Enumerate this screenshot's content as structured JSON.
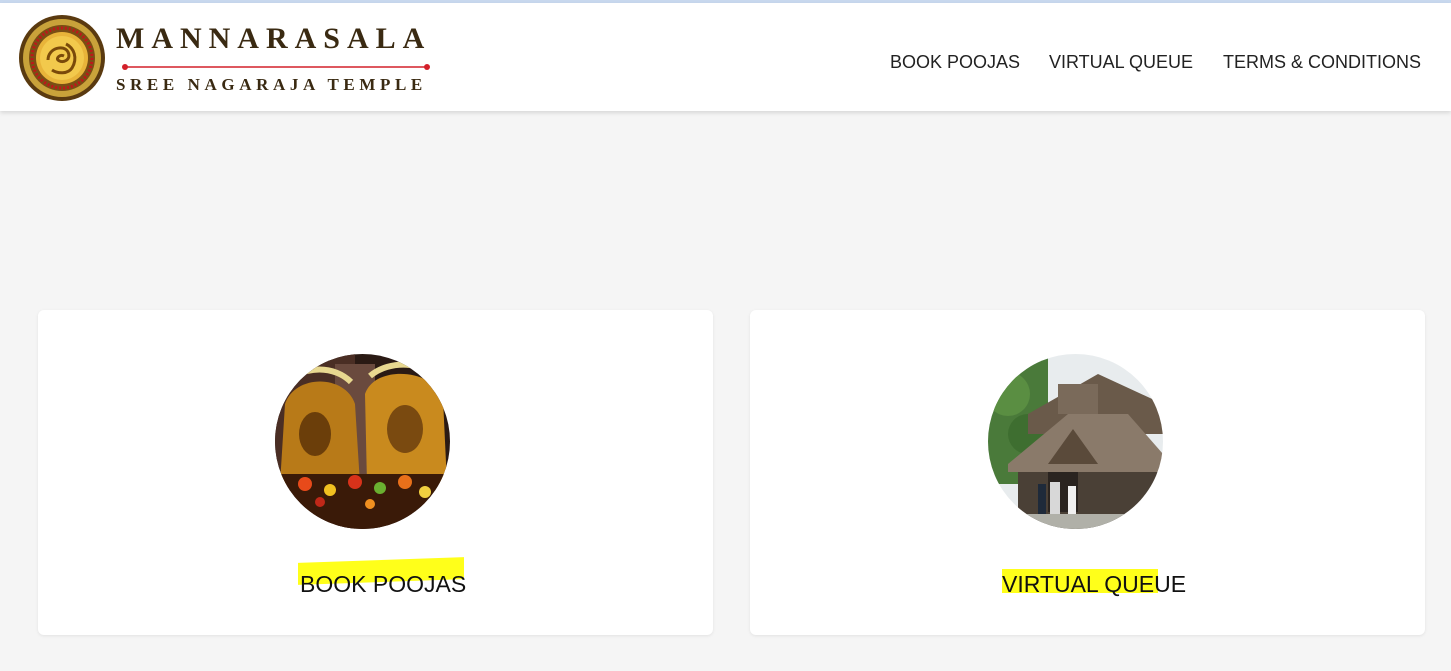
{
  "brand": {
    "title": "MANNARASALA",
    "subtitle": "SREE NAGARAJA TEMPLE",
    "colors": {
      "text": "#3a2a12",
      "emblem_gold": "#c9a23a",
      "emblem_red": "#c0161a",
      "divider_red": "#d3202a"
    }
  },
  "nav": {
    "items": [
      {
        "label": "BOOK POOJAS"
      },
      {
        "label": "VIRTUAL QUEUE"
      },
      {
        "label": "TERMS & CONDITIONS"
      }
    ]
  },
  "cards": [
    {
      "label": "BOOK POOJAS",
      "image": "serpent-idols-with-flowers"
    },
    {
      "label": "VIRTUAL QUEUE",
      "image": "temple-building"
    }
  ],
  "colors": {
    "page_bg": "#f5f5f5",
    "card_bg": "#ffffff",
    "highlight": "#ffff1a"
  }
}
